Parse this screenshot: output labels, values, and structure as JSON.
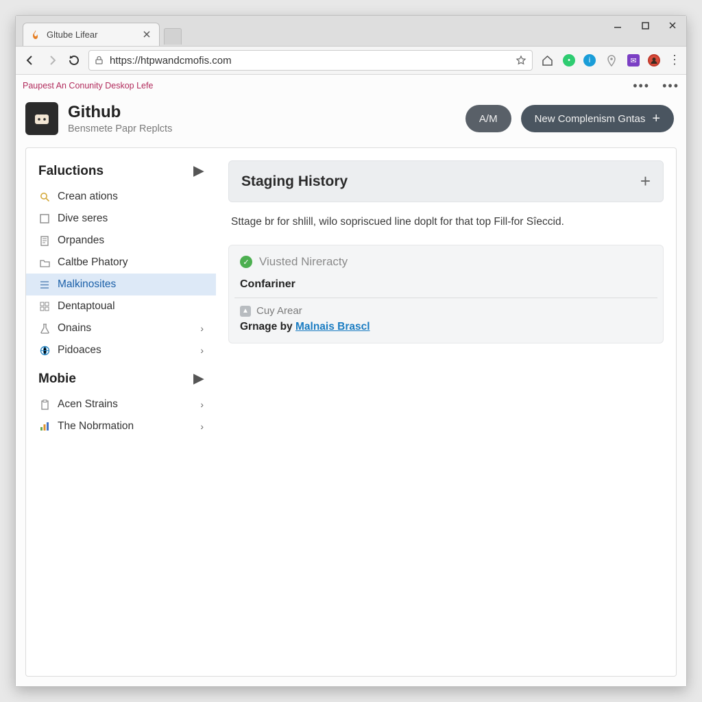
{
  "browser": {
    "tab_title": "Gltube Lifear",
    "url": "https://htpwandcmofis.com"
  },
  "breadcrumb": "Paupest An Conunity Deskop Lefe",
  "header": {
    "title": "Github",
    "subtitle": "Bensmete Papr Replcts",
    "btn_small": "A/M",
    "btn_large": "New Complenism Gntas",
    "btn_large_plus": "+"
  },
  "sidebar": {
    "section1_title": "Faluctions",
    "items1": [
      {
        "label": "Crean ations",
        "icon": "search",
        "chev": false,
        "active": false
      },
      {
        "label": "Dive seres",
        "icon": "box",
        "chev": false,
        "active": false
      },
      {
        "label": "Orpandes",
        "icon": "doc",
        "chev": false,
        "active": false
      },
      {
        "label": "Caltbe Phatory",
        "icon": "folder",
        "chev": false,
        "active": false
      },
      {
        "label": "Malkinosites",
        "icon": "list",
        "chev": false,
        "active": true
      },
      {
        "label": "Dentaptoual",
        "icon": "grid",
        "chev": false,
        "active": false
      },
      {
        "label": "Onains",
        "icon": "flask",
        "chev": true,
        "active": false
      },
      {
        "label": "Pidoaces",
        "icon": "globe",
        "chev": true,
        "active": false
      }
    ],
    "section2_title": "Mobie",
    "items2": [
      {
        "label": "Acen Strains",
        "icon": "clipboard",
        "chev": true,
        "active": false
      },
      {
        "label": "The Nobrmation",
        "icon": "chart",
        "chev": true,
        "active": false
      }
    ]
  },
  "main": {
    "panel_title": "Staging History",
    "description": "Sttage br for shlill, wilo sopriscued line doplt for that top Fill-for Sîeccid.",
    "card": {
      "status_text": "Viusted Nireracty",
      "title": "Confariner",
      "sub_label": "Cuy Arear",
      "by_label": "Grnage by",
      "by_link": "Malnais Brascl"
    }
  }
}
